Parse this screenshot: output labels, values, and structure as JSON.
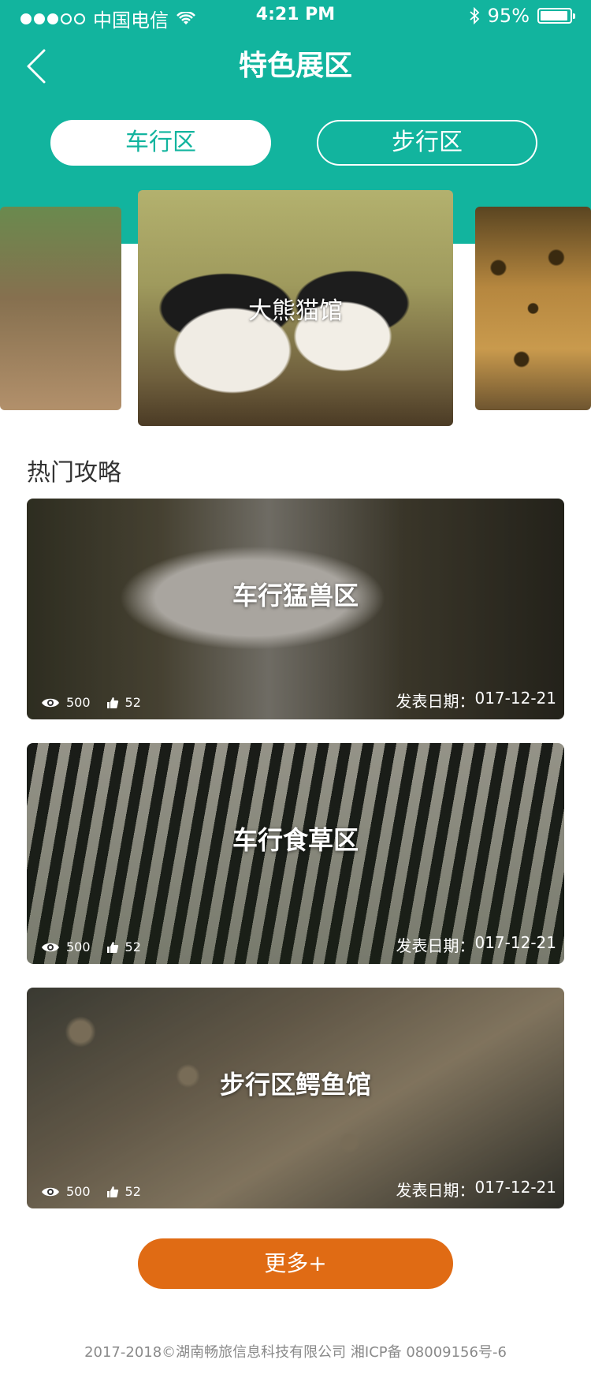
{
  "status_bar": {
    "carrier": "中国电信",
    "time": "4:21 PM",
    "battery_percent": "95%",
    "battery_level": 0.95
  },
  "nav": {
    "title": "特色展区"
  },
  "tabs": [
    {
      "label": "车行区",
      "active": true
    },
    {
      "label": "步行区",
      "active": false
    }
  ],
  "carousel": {
    "center_label": "大熊猫馆"
  },
  "section_title": "热门攻略",
  "guides": [
    {
      "title": "车行猛兽区",
      "views": "500",
      "likes": "52",
      "date_label": "发表日期：",
      "date": "017-12-21"
    },
    {
      "title": "车行食草区",
      "views": "500",
      "likes": "52",
      "date_label": "发表日期：",
      "date": "017-12-21"
    },
    {
      "title": "步行区鳄鱼馆",
      "views": "500",
      "likes": "52",
      "date_label": "发表日期：",
      "date": "017-12-21"
    }
  ],
  "more_button": "更多+",
  "footer": "2017-2018©湖南畅旅信息科技有限公司   湘ICP备 08009156号-6",
  "colors": {
    "teal": "#12b49e",
    "orange": "#e06b14"
  }
}
